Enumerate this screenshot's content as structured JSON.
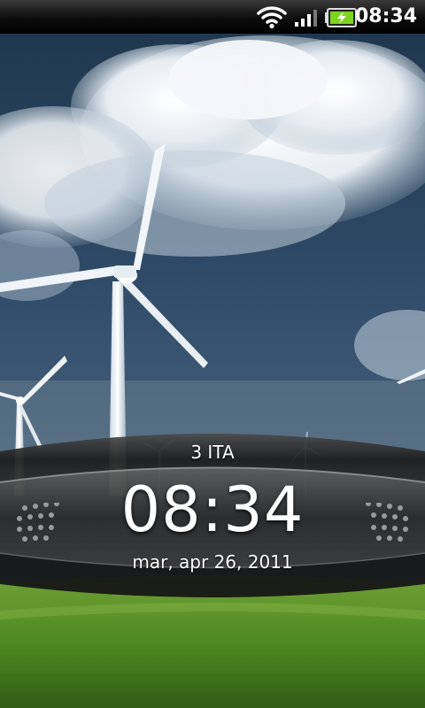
{
  "status_bar": {
    "time": "08:34",
    "icons": [
      "wifi-icon",
      "signal-icon",
      "battery-charging-icon"
    ],
    "battery_color": "#7ed321"
  },
  "lock_screen": {
    "carrier": "3 ITA",
    "clock": "08:34",
    "date": "mar, apr 26, 2011"
  },
  "wallpaper": {
    "sky_color": "#2e4a66",
    "grass_color": "#4f8a23"
  }
}
